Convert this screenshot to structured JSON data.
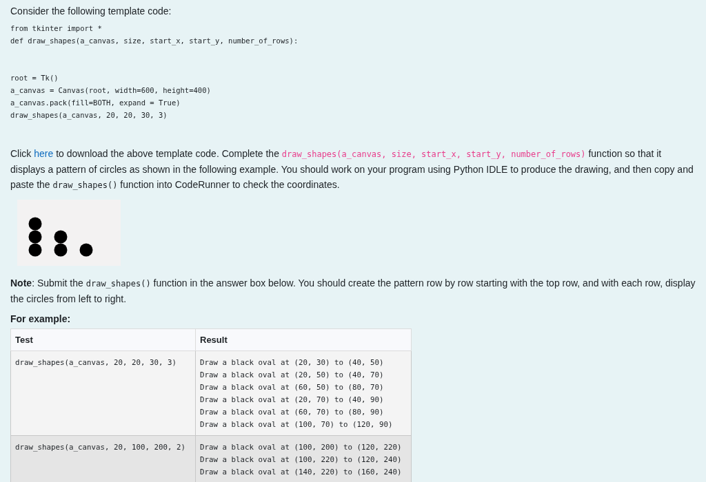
{
  "intro": "Consider the following template code:",
  "code_blocks": [
    [
      "from tkinter import *",
      "def draw_shapes(a_canvas, size, start_x, start_y, number_of_rows):"
    ],
    [
      "root = Tk()",
      "a_canvas = Canvas(root, width=600, height=400)",
      "a_canvas.pack(fill=BOTH, expand = True)",
      "draw_shapes(a_canvas, 20, 20, 30, 3)"
    ]
  ],
  "instructions": [
    {
      "kind": "text",
      "text": "Click "
    },
    {
      "kind": "link",
      "text": "here"
    },
    {
      "kind": "text",
      "text": " to download the above template code. Complete the "
    },
    {
      "kind": "code-pink",
      "text": "draw_shapes(a_canvas, size, start_x, start_y, number_of_rows)"
    },
    {
      "kind": "text",
      "text": " function so that it displays a pattern of circles as shown in the following example. You should work on your program using Python IDLE to produce the drawing, and then copy and paste the "
    },
    {
      "kind": "code",
      "text": "draw_shapes()"
    },
    {
      "kind": "text",
      "text": " function into CodeRunner to check the coordinates."
    }
  ],
  "note": [
    {
      "kind": "bold",
      "text": "Note"
    },
    {
      "kind": "text",
      "text": ": Submit the "
    },
    {
      "kind": "code",
      "text": "draw_shapes()"
    },
    {
      "kind": "text",
      "text": " function in the answer box below. You should create the pattern row by row starting with the top row, and with each row, display the circles from left to right."
    }
  ],
  "example_heading": "For example:",
  "table": {
    "columns": [
      "Test",
      "Result"
    ],
    "rows": [
      {
        "test": "draw_shapes(a_canvas, 20, 20, 30, 3)",
        "result": [
          "Draw a black oval at (20, 30) to (40, 50)",
          "Draw a black oval at (20, 50) to (40, 70)",
          "Draw a black oval at (60, 50) to (80, 70)",
          "Draw a black oval at (20, 70) to (40, 90)",
          "Draw a black oval at (60, 70) to (80, 90)",
          "Draw a black oval at (100, 70) to (120, 90)"
        ]
      },
      {
        "test": "draw_shapes(a_canvas, 20, 100, 200, 2)",
        "result": [
          "Draw a black oval at (100, 200) to (120, 220)",
          "Draw a black oval at (100, 220) to (120, 240)",
          "Draw a black oval at (140, 220) to (160, 240)"
        ]
      }
    ]
  }
}
